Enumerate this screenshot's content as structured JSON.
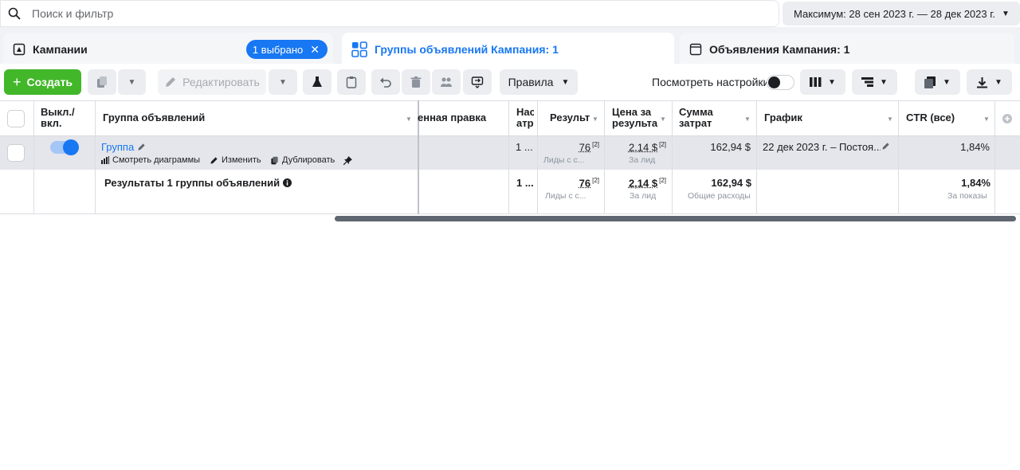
{
  "search": {
    "placeholder": "Поиск и фильтр",
    "icon": "search-icon"
  },
  "date_range": {
    "label": "Максимум: 28 сен 2023 г. — 28 дек 2023 г."
  },
  "tabs": {
    "campaigns": {
      "label": "Кампании",
      "selected_pill": "1 выбрано"
    },
    "adsets": {
      "label": "Группы объявлений Кампания: 1"
    },
    "ads": {
      "label": "Объявления Кампания: 1"
    }
  },
  "toolbar": {
    "create": "Создать",
    "edit": "Редактировать",
    "rules": "Правила",
    "view_settings": "Посмотреть настройки"
  },
  "table": {
    "headers": {
      "onoff": "Выкл./ вкл.",
      "adset": "Группа объявлений",
      "last_edit": "енная правка",
      "setup": "Нас атр",
      "results": "Результ",
      "cost": "Цена за результа",
      "spent": "Сумма затрат",
      "schedule": "График",
      "ctr": "CTR (все)"
    },
    "row": {
      "name": "Группа",
      "actions": {
        "charts": "Смотреть диаграммы",
        "edit": "Изменить",
        "duplicate": "Дублировать"
      },
      "setup": "1 ...",
      "results": "76",
      "results_sup": "[2]",
      "results_sub": "Лиды с с...",
      "cost": "2,14 $",
      "cost_sup": "[2]",
      "cost_sub": "За лид",
      "spent": "162,94 $",
      "schedule": "22 дек 2023 г. – Постоя...",
      "ctr": "1,84%"
    },
    "summary": {
      "label": "Результаты 1 группы объявлений",
      "setup": "1 ...",
      "results": "76",
      "results_sup": "[2]",
      "results_sub": "Лиды с с...",
      "cost": "2,14 $",
      "cost_sup": "[2]",
      "cost_sub": "За лид",
      "spent": "162,94 $",
      "spent_sub": "Общие расходы",
      "ctr": "1,84%",
      "ctr_sub": "За показы"
    }
  },
  "colors": {
    "accent": "#1877f2",
    "create": "#42b72a"
  }
}
